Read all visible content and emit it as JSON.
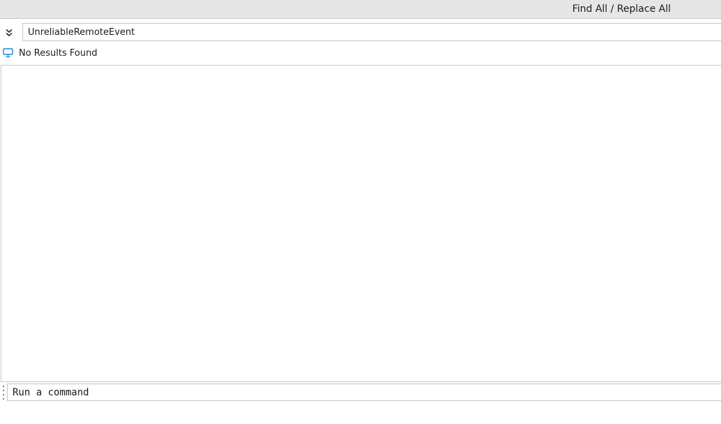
{
  "window": {
    "title": "Find All / Replace All"
  },
  "search": {
    "value": "UnreliableRemoteEvent",
    "expand_icon": "double-chevron-down-icon"
  },
  "status": {
    "icon": "monitor-icon",
    "icon_color": "#1a8ad4",
    "text": "No Results Found"
  },
  "command_bar": {
    "placeholder": "Run a command"
  }
}
